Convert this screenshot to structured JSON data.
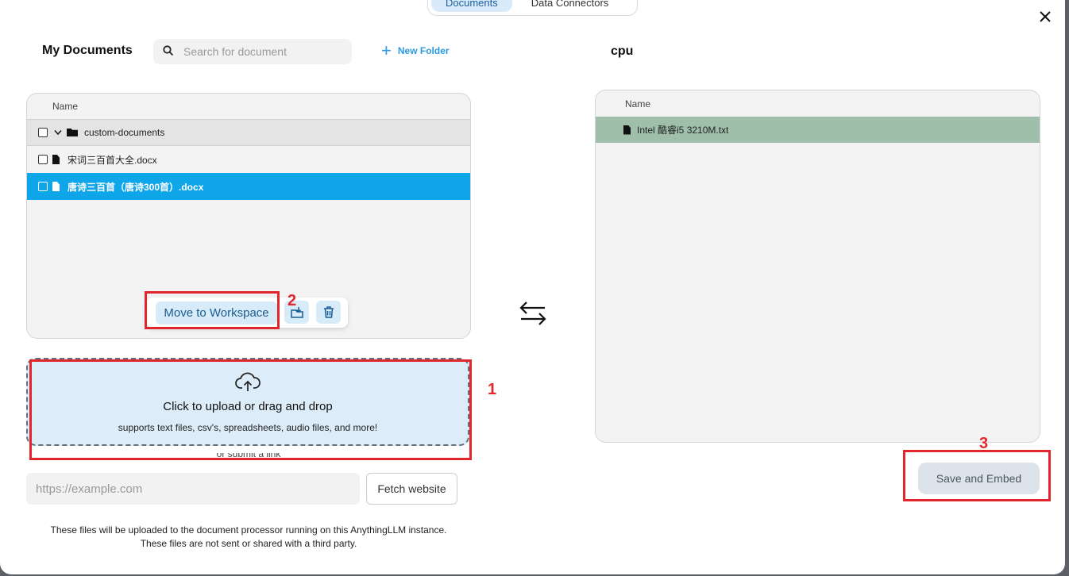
{
  "tabs": [
    {
      "label": "Documents"
    },
    {
      "label": "Data Connectors"
    }
  ],
  "my_documents": {
    "title": "My Documents",
    "search_placeholder": "Search for document",
    "new_folder_label": "New Folder",
    "header_name": "Name",
    "rows": [
      {
        "label": "custom-documents",
        "type": "folder",
        "checked": false,
        "selected": false
      },
      {
        "label": "宋词三百首大全.docx",
        "type": "file",
        "checked": false,
        "selected": false
      },
      {
        "label": "唐诗三百首（唐诗300首）.docx",
        "type": "file",
        "checked": true,
        "selected": true
      }
    ],
    "move_to_workspace_label": "Move to Workspace"
  },
  "workspace": {
    "title": "cpu",
    "header_name": "Name",
    "rows": [
      {
        "label": "Intel 酷睿i5 3210M.txt",
        "type": "file"
      }
    ],
    "save_label": "Save and Embed"
  },
  "upload": {
    "title": "Click to upload or drag and drop",
    "subtitle": "supports text files, csv's, spreadsheets, audio files, and more!",
    "or_label": "or submit a link"
  },
  "fetch": {
    "placeholder": "https://example.com",
    "button_label": "Fetch website"
  },
  "notes": {
    "line1": "These files will be uploaded to the document processor running on this AnythingLLM instance.",
    "line2": "These files are not sent or shared with a third party."
  },
  "annotations": {
    "one": "1",
    "two": "2",
    "three": "3"
  },
  "colors": {
    "accent": "#0ea5e9",
    "highlight_row": "#9fbfaa",
    "annotation": "#e1272d",
    "upload_bg": "#dcecf8"
  }
}
